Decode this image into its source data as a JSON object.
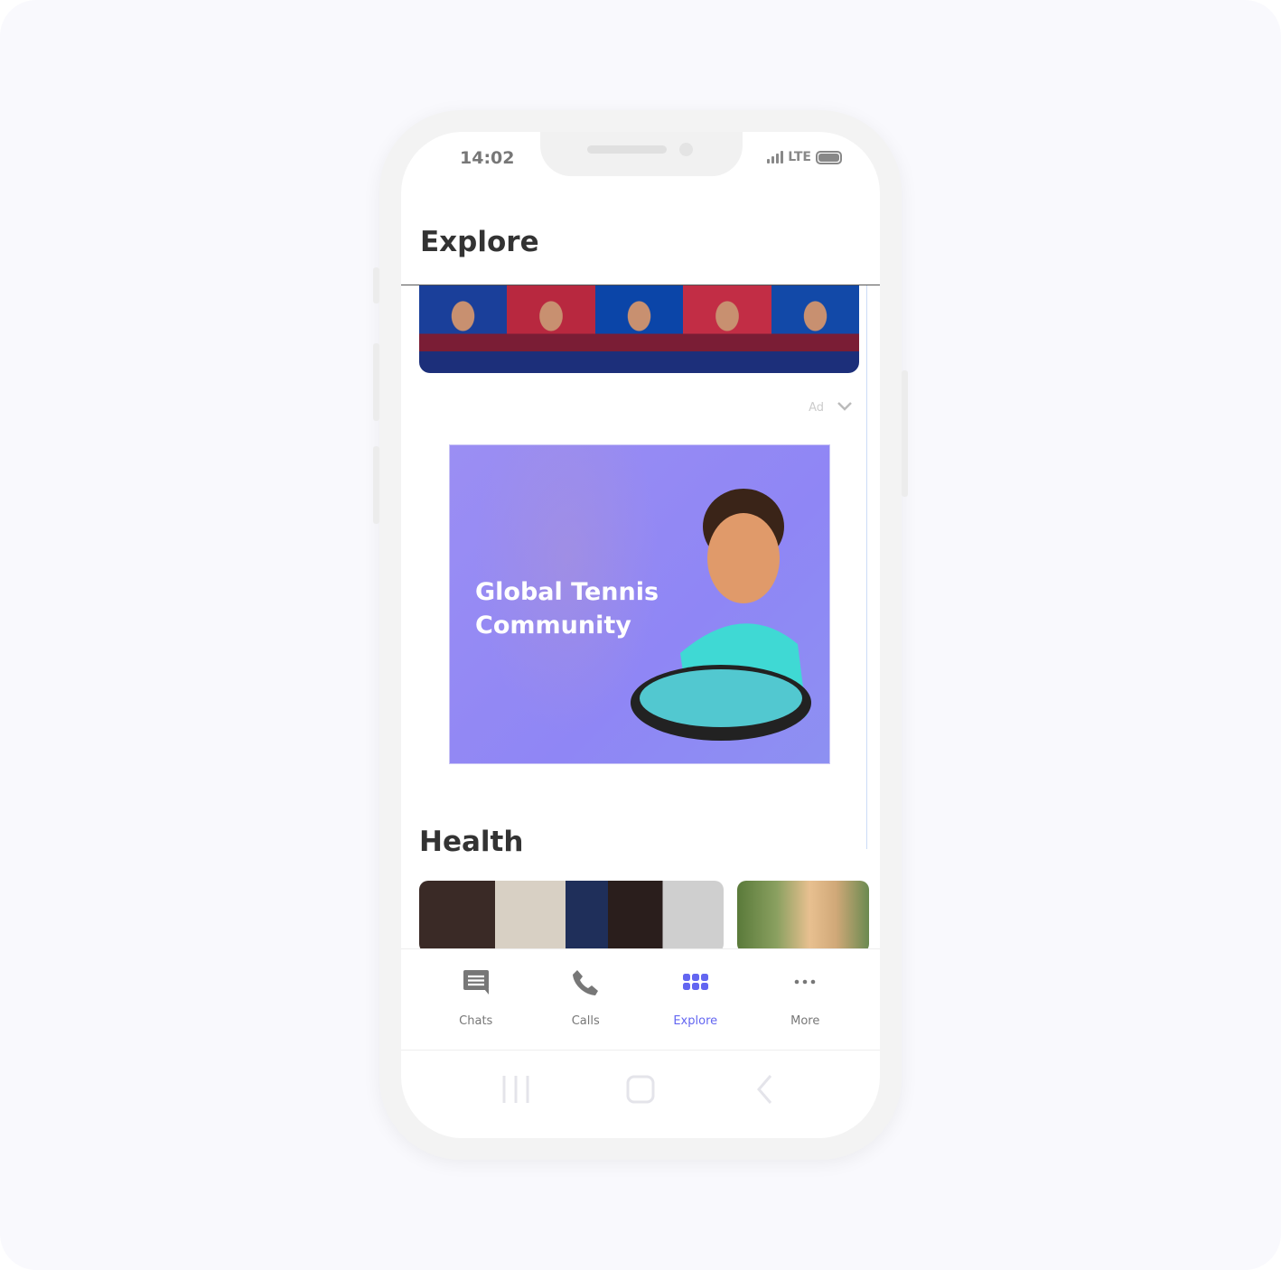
{
  "status_bar": {
    "time": "14:02",
    "network": "LTE"
  },
  "header": {
    "title": "Explore"
  },
  "banner": {
    "colors": [
      "#1a3f9a",
      "#b8283f",
      "#0b45a8",
      "#c22d45",
      "#1249a8"
    ]
  },
  "ad": {
    "label": "Ad",
    "headline_line1": "Global Tennis",
    "headline_line2": "Community",
    "background": "#998cf4"
  },
  "section": {
    "title": "Health"
  },
  "bottom_nav": {
    "items": [
      {
        "label": "Chats",
        "icon": "chat-icon"
      },
      {
        "label": "Calls",
        "icon": "phone-icon"
      },
      {
        "label": "Explore",
        "icon": "grid-icon",
        "active": true
      },
      {
        "label": "More",
        "icon": "more-icon"
      }
    ],
    "active_color": "#6366f1"
  }
}
